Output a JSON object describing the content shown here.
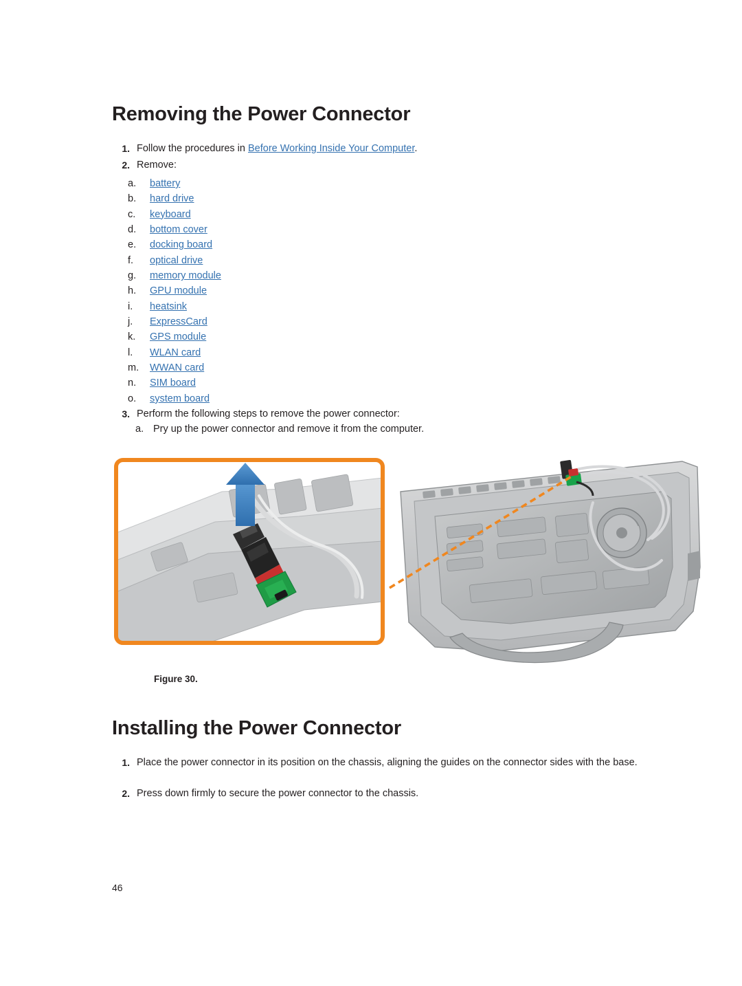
{
  "document": {
    "page_number": "46"
  },
  "sections": [
    {
      "title": "Removing the Power Connector"
    },
    {
      "title": "Installing the Power Connector"
    }
  ],
  "removing": {
    "title": "Removing the Power Connector",
    "step1": {
      "number": "1.",
      "text_before": "Follow the procedures in ",
      "link": "Before Working Inside Your Computer",
      "text_after": "."
    },
    "step2": {
      "number": "2.",
      "text": "Remove:"
    },
    "remove_items": [
      {
        "marker": "a.",
        "label": "battery"
      },
      {
        "marker": "b.",
        "label": "hard drive"
      },
      {
        "marker": "c.",
        "label": "keyboard"
      },
      {
        "marker": "d.",
        "label": "bottom cover"
      },
      {
        "marker": "e.",
        "label": "docking board"
      },
      {
        "marker": "f.",
        "label": "optical drive"
      },
      {
        "marker": "g.",
        "label": "memory module"
      },
      {
        "marker": "h.",
        "label": "GPU module"
      },
      {
        "marker": "i.",
        "label": "heatsink"
      },
      {
        "marker": "j.",
        "label": "ExpressCard"
      },
      {
        "marker": "k.",
        "label": "GPS module"
      },
      {
        "marker": "l.",
        "label": "WLAN card"
      },
      {
        "marker": "m.",
        "label": "WWAN card"
      },
      {
        "marker": "n.",
        "label": "SIM board"
      },
      {
        "marker": "o.",
        "label": "system board"
      }
    ],
    "step3": {
      "number": "3.",
      "text": "Perform the following steps to remove the power connector:"
    },
    "step3a": {
      "marker": "a.",
      "text": "Pry up the power connector and remove it from the computer."
    },
    "figure_caption": "Figure 30."
  },
  "installing": {
    "title": "Installing the Power Connector",
    "step1": {
      "number": "1.",
      "text": "Place the power connector in its position on the chassis, aligning the guides on the connector sides with the base."
    },
    "step2": {
      "number": "2.",
      "text": "Press down firmly to secure the power connector to the chassis."
    }
  },
  "colors": {
    "link": "#3572b0",
    "callout_border": "#f0871f",
    "arrow": "#3d7fc1",
    "text": "#231f20"
  }
}
